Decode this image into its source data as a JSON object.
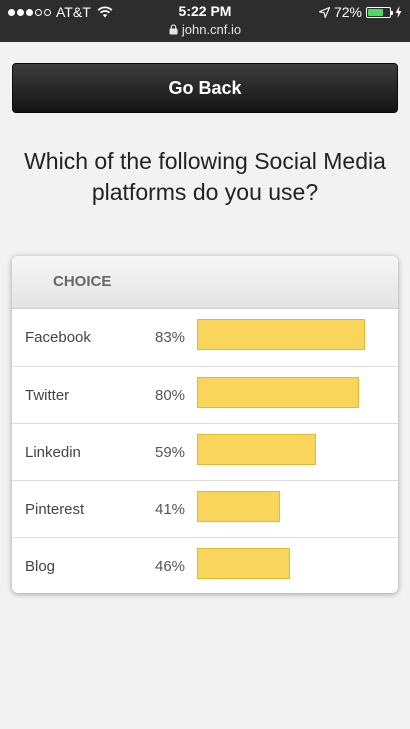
{
  "status_bar": {
    "carrier": "AT&T",
    "time": "5:22 PM",
    "url": "john.cnf.io",
    "battery_percent": "72%",
    "battery_level": 0.72,
    "signal_bars_filled": 3,
    "icons": [
      "signal-dots-icon",
      "wifi-icon",
      "lock-icon",
      "location-arrow-icon",
      "battery-icon",
      "charging-bolt-icon"
    ]
  },
  "go_back": {
    "label": "Go Back"
  },
  "question": "Which of the following Social Media platforms do you use?",
  "results": {
    "header": "CHOICE",
    "bar_color": "#fad55c",
    "rows": [
      {
        "label": "Facebook",
        "percent_text": "83%",
        "percent": 83
      },
      {
        "label": "Twitter",
        "percent_text": "80%",
        "percent": 80
      },
      {
        "label": "Linkedin",
        "percent_text": "59%",
        "percent": 59
      },
      {
        "label": "Pinterest",
        "percent_text": "41%",
        "percent": 41
      },
      {
        "label": "Blog",
        "percent_text": "46%",
        "percent": 46
      }
    ]
  }
}
